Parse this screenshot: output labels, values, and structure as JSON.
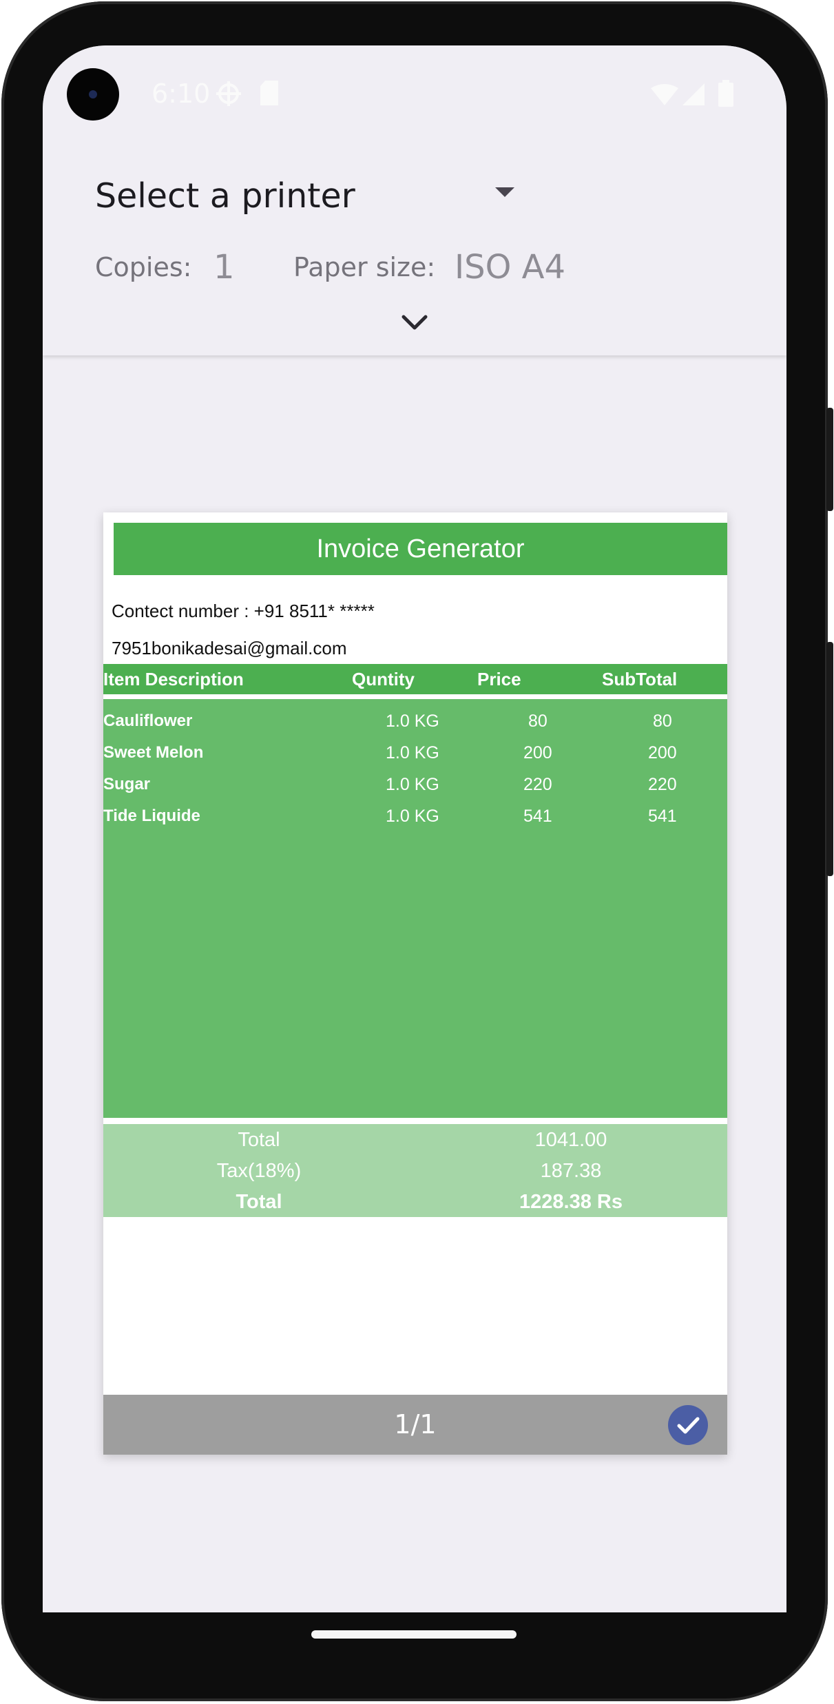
{
  "status_bar": {
    "time": "6:10"
  },
  "print_options": {
    "printer_label": "Select a printer",
    "copies_label": "Copies:",
    "copies_value": "1",
    "paper_size_label": "Paper size:",
    "paper_size_value": "ISO A4"
  },
  "invoice": {
    "title": "Invoice Generator",
    "contact": "Contect number : +91 8511* *****",
    "email": "7951bonikadesai@gmail.com",
    "columns": [
      "Item Description",
      "Quntity",
      "Price",
      "SubTotal"
    ],
    "rows": [
      {
        "description": "Cauliflower",
        "quantity": "1.0 KG",
        "price": "80",
        "subtotal": "80"
      },
      {
        "description": "Sweet Melon",
        "quantity": "1.0 KG",
        "price": "200",
        "subtotal": "200"
      },
      {
        "description": "Sugar",
        "quantity": "1.0 KG",
        "price": "220",
        "subtotal": "220"
      },
      {
        "description": "Tide Liquide",
        "quantity": "1.0 KG",
        "price": "541",
        "subtotal": "541"
      }
    ],
    "totals": [
      {
        "label": "Total",
        "value": "1041.00"
      },
      {
        "label": "Tax(18%)",
        "value": "187.38"
      },
      {
        "label": "Total",
        "value": "1228.38 Rs"
      }
    ]
  },
  "preview": {
    "page_indicator": "1/1"
  },
  "colors": {
    "invoice_green": "#4caf50",
    "table_green": "#66bb6a",
    "totals_green": "#a5d6a7",
    "checkbox_blue": "#4b5ea5"
  }
}
